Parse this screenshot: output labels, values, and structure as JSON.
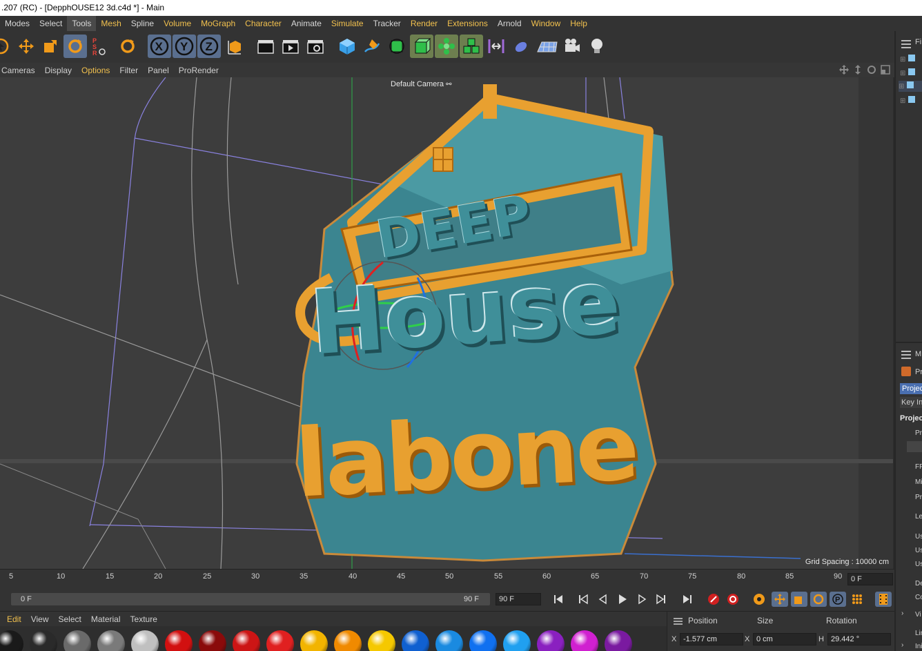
{
  "window": {
    "title": ".207 (RC) - [DepphOUSE12 3d.c4d *] - Main"
  },
  "menu": {
    "items": [
      "Modes",
      "Select",
      "Tools",
      "Mesh",
      "Spline",
      "Volume",
      "MoGraph",
      "Character",
      "Animate",
      "Simulate",
      "Tracker",
      "Render",
      "Extensions",
      "Arnold",
      "Window",
      "Help"
    ]
  },
  "viewport_menu": {
    "items": [
      "Cameras",
      "Display",
      "Options",
      "Filter",
      "Panel",
      "ProRender"
    ]
  },
  "viewport": {
    "camera_label": "Default Camera",
    "grid_spacing": "Grid Spacing : 10000 cm",
    "logo_words": [
      "DEEP",
      "House",
      "labone"
    ]
  },
  "timeline": {
    "ticks": [
      "5",
      "10",
      "15",
      "20",
      "25",
      "30",
      "35",
      "40",
      "45",
      "50",
      "55",
      "60",
      "65",
      "70",
      "75",
      "80",
      "85",
      "90"
    ],
    "current_frame": "0 F",
    "range_start": "0 F",
    "range_end": "90 F",
    "end_frame": "90 F"
  },
  "material_menu": {
    "items": [
      "Edit",
      "View",
      "Select",
      "Material",
      "Texture"
    ]
  },
  "materials": {
    "colors": [
      "#1a1a1a",
      "#2a2a2a",
      "#6a6a6a",
      "#7a7a7a",
      "#c0c0c0",
      "#d21010",
      "#8a0a0a",
      "#cc1515",
      "#e02020",
      "#f2b400",
      "#f08a00",
      "#f5c800",
      "#1060d0",
      "#1a8ae0",
      "#1070f0",
      "#20a0f0",
      "#8a20c0",
      "#d020d0",
      "#7a1aa0"
    ]
  },
  "coordinates": {
    "headers": {
      "position": "Position",
      "size": "Size",
      "rotation": "Rotation"
    },
    "x_label": "X",
    "x_position": "-1.577 cm",
    "size_label": "X",
    "x_size": "0 cm",
    "rot_label": "H",
    "h_rotation": "29.442 °"
  },
  "right_panel": {
    "labels": [
      "Fi",
      "M",
      "Pr",
      "Projec",
      "Key In",
      "Projec",
      "Pr",
      "FP",
      "Mi",
      "Pr",
      "Le",
      "Us",
      "Us",
      "Us",
      "De",
      "Co",
      "Vi",
      "Lin",
      "Ini"
    ]
  },
  "colors": {
    "accent": "#f2c14e",
    "selection": "#5a6f8f",
    "logo_teal": "#3f8f99",
    "logo_orange": "#e8a030"
  }
}
